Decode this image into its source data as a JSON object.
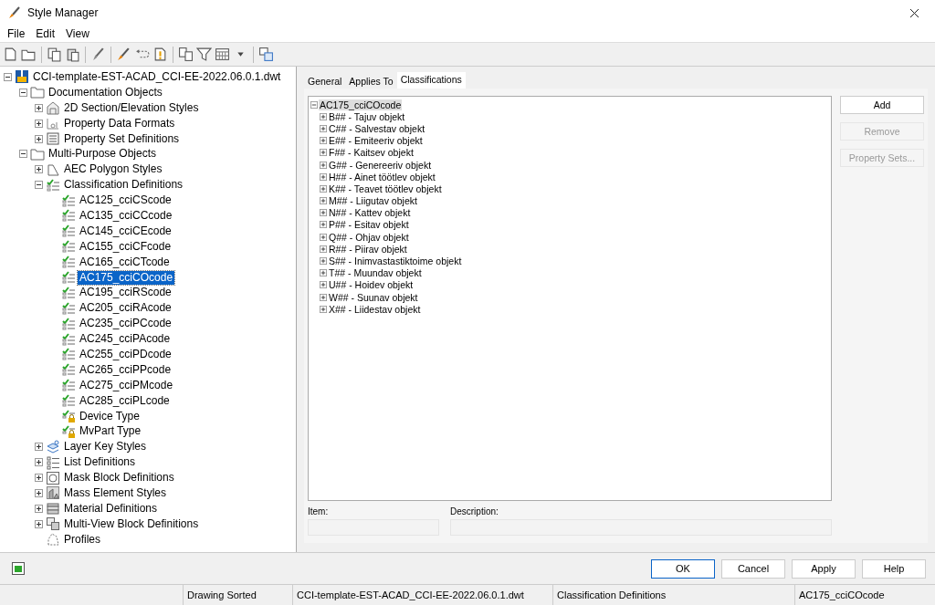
{
  "window": {
    "title": "Style Manager"
  },
  "menu": [
    {
      "label": "File"
    },
    {
      "label": "Edit"
    },
    {
      "label": "View"
    }
  ],
  "tree": {
    "label": "CCI-template-EST-ACAD_CCI-EE-2022.06.0.1.dwt",
    "kind": "drawing",
    "expanded": true,
    "selected": false,
    "children": [
      {
        "label": "Documentation Objects",
        "kind": "folder",
        "expanded": true,
        "selected": false,
        "children": [
          {
            "label": "2D Section/Elevation Styles",
            "kind": "section",
            "expanded": false,
            "selected": false
          },
          {
            "label": "Property Data Formats",
            "kind": "format",
            "expanded": false,
            "selected": false
          },
          {
            "label": "Property Set Definitions",
            "kind": "propset",
            "expanded": false,
            "selected": false
          }
        ]
      },
      {
        "label": "Multi-Purpose Objects",
        "kind": "folder",
        "expanded": true,
        "selected": false,
        "children": [
          {
            "label": "AEC Polygon Styles",
            "kind": "polygon",
            "expanded": false,
            "selected": false
          },
          {
            "label": "Classification Definitions",
            "kind": "classification",
            "expanded": true,
            "selected": false,
            "children": [
              {
                "label": "AC125_cciCScode",
                "kind": "classification",
                "selected": false
              },
              {
                "label": "AC135_cciCCcode",
                "kind": "classification",
                "selected": false
              },
              {
                "label": "AC145_cciCEcode",
                "kind": "classification",
                "selected": false
              },
              {
                "label": "AC155_cciCFcode",
                "kind": "classification",
                "selected": false
              },
              {
                "label": "AC165_cciCTcode",
                "kind": "classification",
                "selected": false
              },
              {
                "label": "AC175_cciCOcode",
                "kind": "classification",
                "selected": true
              },
              {
                "label": "AC195_cciRScode",
                "kind": "classification",
                "selected": false
              },
              {
                "label": "AC205_cciRAcode",
                "kind": "classification",
                "selected": false
              },
              {
                "label": "AC235_cciPCcode",
                "kind": "classification",
                "selected": false
              },
              {
                "label": "AC245_cciPAcode",
                "kind": "classification",
                "selected": false
              },
              {
                "label": "AC255_cciPDcode",
                "kind": "classification",
                "selected": false
              },
              {
                "label": "AC265_cciPPcode",
                "kind": "classification",
                "selected": false
              },
              {
                "label": "AC275_cciPMcode",
                "kind": "classification",
                "selected": false
              },
              {
                "label": "AC285_cciPLcode",
                "kind": "classification",
                "selected": false
              },
              {
                "label": "Device Type",
                "kind": "locked",
                "selected": false
              },
              {
                "label": "MvPart Type",
                "kind": "locked",
                "selected": false
              }
            ]
          },
          {
            "label": "Layer Key Styles",
            "kind": "layerkey",
            "expanded": false,
            "selected": false
          },
          {
            "label": "List Definitions",
            "kind": "list",
            "expanded": false,
            "selected": false
          },
          {
            "label": "Mask Block Definitions",
            "kind": "mask",
            "expanded": false,
            "selected": false
          },
          {
            "label": "Mass Element Styles",
            "kind": "mass",
            "expanded": false,
            "selected": false
          },
          {
            "label": "Material Definitions",
            "kind": "material",
            "expanded": false,
            "selected": false
          },
          {
            "label": "Multi-View Block Definitions",
            "kind": "mvblock",
            "expanded": false,
            "selected": false
          },
          {
            "label": "Profiles",
            "kind": "profile",
            "selected": false
          }
        ]
      }
    ]
  },
  "tabs": [
    {
      "label": "General",
      "selected": false
    },
    {
      "label": "Applies To",
      "selected": false
    },
    {
      "label": "Classifications",
      "selected": true
    }
  ],
  "class_tree": {
    "label": "AC175_cciCOcode",
    "expanded": true,
    "selected": true,
    "children": [
      {
        "label": "B## - Tajuv objekt",
        "expanded": false
      },
      {
        "label": "C## - Salvestav objekt",
        "expanded": false
      },
      {
        "label": "E## - Emiteeriv objekt",
        "expanded": false
      },
      {
        "label": "F## - Kaitsev objekt",
        "expanded": false
      },
      {
        "label": "G## - Genereeriv objekt",
        "expanded": false
      },
      {
        "label": "H## - Ainet töötlev objekt",
        "expanded": false
      },
      {
        "label": "K## - Teavet töötlev objekt",
        "expanded": false
      },
      {
        "label": "M## - Liigutav objekt",
        "expanded": false
      },
      {
        "label": "N## - Kattev objekt",
        "expanded": false
      },
      {
        "label": "P## - Esitav objekt",
        "expanded": false
      },
      {
        "label": "Q## - Ohjav objekt",
        "expanded": false
      },
      {
        "label": "R## - Piirav objekt",
        "expanded": false
      },
      {
        "label": "S## - Inimvastastiktoime objekt",
        "expanded": false
      },
      {
        "label": "T## - Muundav objekt",
        "expanded": false
      },
      {
        "label": "U## - Hoidev objekt",
        "expanded": false
      },
      {
        "label": "W## - Suunav objekt",
        "expanded": false
      },
      {
        "label": "X## - Liidestav objekt",
        "expanded": false
      }
    ]
  },
  "side_buttons": [
    {
      "label": "Add",
      "disabled": false
    },
    {
      "label": "Remove",
      "disabled": true
    },
    {
      "label": "Property Sets...",
      "disabled": true
    }
  ],
  "fields": [
    {
      "label": "Item:",
      "disabled": true
    },
    {
      "label": "Description:",
      "disabled": true
    }
  ],
  "dialog_buttons": [
    {
      "label": "OK",
      "default": true
    },
    {
      "label": "Cancel",
      "default": false
    },
    {
      "label": "Apply",
      "default": false
    },
    {
      "label": "Help",
      "default": false
    }
  ],
  "status_bar": [
    "Drawing Sorted",
    "CCI-template-EST-ACAD_CCI-EE-2022.06.0.1.dwt",
    "Classification Definitions",
    "AC175_cciCOcode"
  ]
}
